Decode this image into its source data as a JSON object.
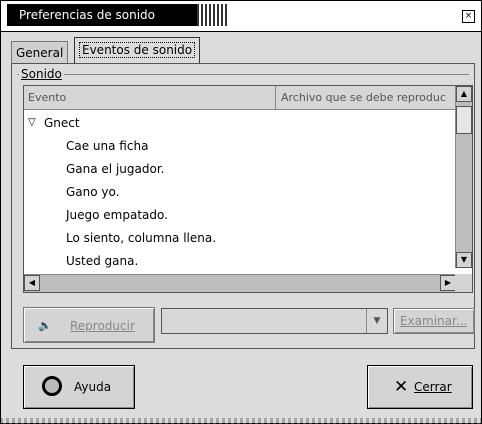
{
  "window": {
    "title": "Preferencias de sonido",
    "close_glyph": "×"
  },
  "tabs": [
    {
      "label": "General",
      "active": false
    },
    {
      "label": "Eventos de sonido",
      "active": true
    }
  ],
  "group": {
    "label": "Sonido"
  },
  "table": {
    "columns": [
      "Evento",
      "Archivo que se debe reproduc"
    ],
    "parent": {
      "expand_glyph": "▽",
      "label": "Gnect"
    },
    "children": [
      "Cae una ficha",
      "Gana el jugador.",
      "Gano yo.",
      "Juego empatado.",
      "Lo siento, columna llena.",
      "Usted gana."
    ]
  },
  "controls": {
    "play_icon": "speaker-icon",
    "play_icon_glyph": "🔈",
    "play_label": "Reproducir",
    "file_combo_value": "",
    "browse_label": "Examinar..."
  },
  "buttons": {
    "help_label": "Ayuda",
    "close_glyph": "✕",
    "close_label": "Cerrar"
  },
  "colors": {
    "titlebar_bg": "#000000",
    "window_bg": "#dcdcdc",
    "list_bg": "#ffffff"
  }
}
